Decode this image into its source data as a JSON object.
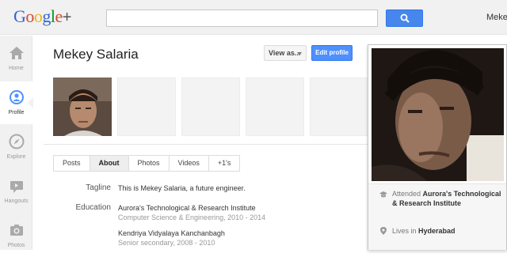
{
  "header": {
    "logo": "Google+",
    "search_placeholder": "",
    "username": "Mekey"
  },
  "rail": {
    "items": [
      {
        "label": "Home",
        "icon": "home-icon"
      },
      {
        "label": "Profile",
        "icon": "profile-icon"
      },
      {
        "label": "Explore",
        "icon": "compass-icon"
      },
      {
        "label": "Hangouts",
        "icon": "video-camera-icon"
      },
      {
        "label": "Photos",
        "icon": "camera-icon"
      }
    ],
    "active": "Profile"
  },
  "profile": {
    "name": "Mekey Salaria",
    "view_as": "View as...",
    "edit_profile": "Edit profile"
  },
  "tabs": [
    "Posts",
    "About",
    "Photos",
    "Videos",
    "+1's"
  ],
  "active_tab": "About",
  "about": {
    "tagline_label": "Tagline",
    "tagline": "This is Mekey Salaria, a future engineer.",
    "education_label": "Education",
    "education": [
      {
        "school": "Aurora's Technological & Research Institute",
        "detail": "Computer Science & Engineering, 2010 - 2014"
      },
      {
        "school": "Kendriya Vidyalaya Kanchanbagh",
        "detail": "Senior secondary, 2008 - 2010"
      }
    ]
  },
  "hovercard": {
    "attended_prefix": "Attended",
    "attended": "Aurora's Technological & Research Institute",
    "lives_prefix": "Lives in",
    "lives": "Hyderabad"
  },
  "colors": {
    "accent_blue": "#4d90fe",
    "search_blue": "#4787ed",
    "topbar_bg": "#f1f1f1"
  }
}
